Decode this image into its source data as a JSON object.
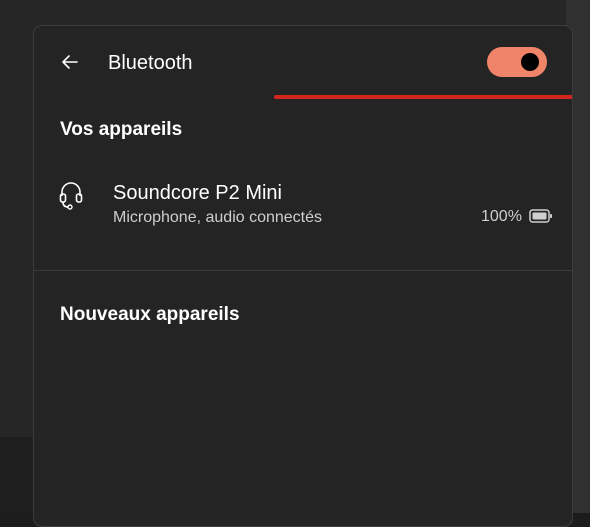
{
  "header": {
    "back_icon": "back-arrow-icon",
    "title": "Bluetooth",
    "toggle": {
      "state": "on",
      "color": "#f08468"
    }
  },
  "sections": {
    "my_devices": "Vos appareils",
    "new_devices": "Nouveaux appareils"
  },
  "device": {
    "icon": "headset-icon",
    "name": "Soundcore P2 Mini",
    "status": "Microphone, audio connectés",
    "battery": "100%",
    "battery_icon": "battery-icon"
  },
  "colors": {
    "panel_bg": "#242424",
    "annotation": "#d1251d"
  }
}
